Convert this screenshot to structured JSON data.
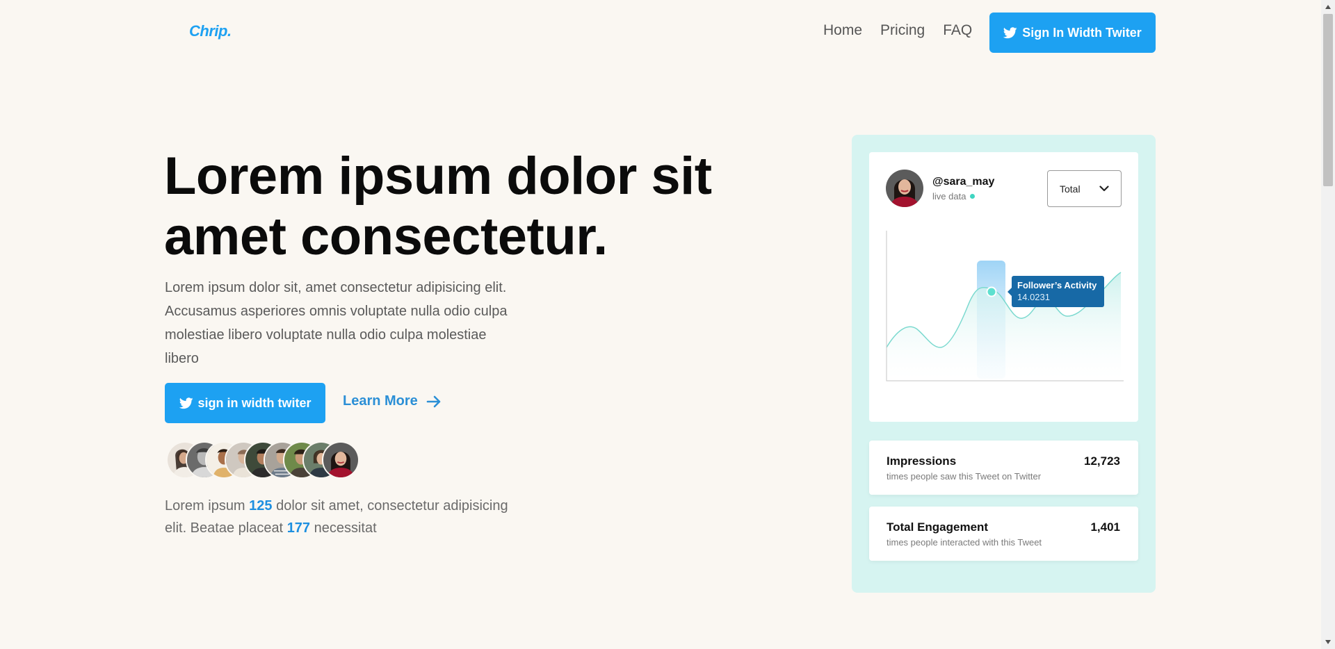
{
  "brand": {
    "logo": "Chrip."
  },
  "nav": {
    "links": [
      "Home",
      "Pricing",
      "FAQ"
    ],
    "cta_label": "Sign In Width Twiter"
  },
  "hero": {
    "title_line1": "Lorem ipsum dolor sit",
    "title_line2": "amet consectetur.",
    "description": "Lorem ipsum dolor sit, amet consectetur adipisicing elit. Accusamus asperiores omnis voluptate nulla odio culpa molestiae libero voluptate nulla odio culpa molestiae libero",
    "cta_label": "sign in width twiter",
    "learn_more": "Learn More",
    "note": {
      "part1": "Lorem ipsum ",
      "num1": "125",
      "part2": " dolor sit amet, consectetur adipisicing elit. Beatae placeat ",
      "num2": "177",
      "part3": " necessitat"
    },
    "avatar_count": 9
  },
  "dashboard": {
    "handle": "@sara_may",
    "status": "live data",
    "select_value": "Total",
    "tooltip": {
      "title": "Follower’s Activity",
      "value": "14.0231"
    },
    "stats": [
      {
        "label": "Impressions",
        "sub": "times people saw this Tweet on Twitter",
        "value": "12,723"
      },
      {
        "label": "Total Engagement",
        "sub": "times people interacted with this Tweet",
        "value": "1,401"
      }
    ]
  },
  "colors": {
    "accent": "#1da1f2",
    "link": "#2b8fd6",
    "panel": "#d6f4f1",
    "live_dot": "#3fd5c1",
    "tooltip": "#1769a6",
    "page_bg": "#faf7f2"
  },
  "icons": [
    "twitter-bird-icon",
    "arrow-right-icon",
    "chevron-down-icon",
    "scroll-up-arrow-icon",
    "scroll-down-arrow-icon"
  ]
}
